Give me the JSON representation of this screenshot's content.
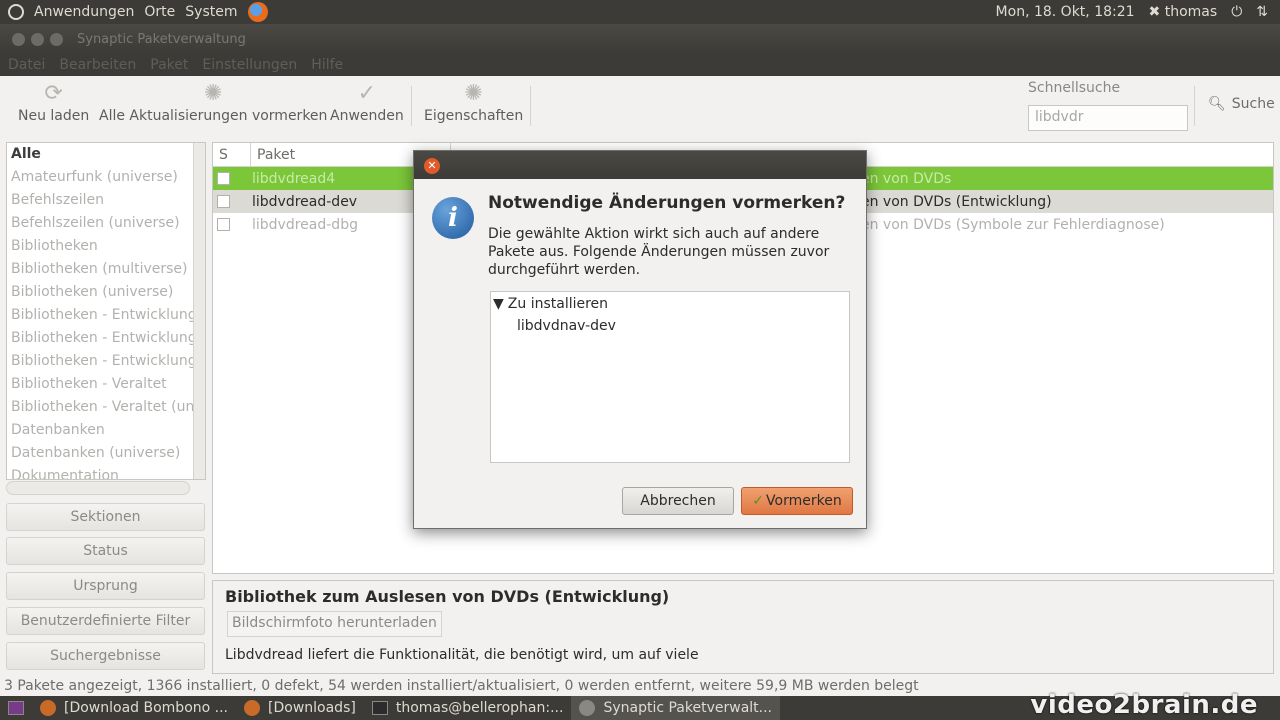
{
  "topbar": {
    "menus": [
      "Anwendungen",
      "Orte",
      "System"
    ],
    "clock": "Mon, 18. Okt, 18:21",
    "user": "thomas"
  },
  "window": {
    "title": "Synaptic Paketverwaltung",
    "menu": [
      "Datei",
      "Bearbeiten",
      "Paket",
      "Einstellungen",
      "Hilfe"
    ]
  },
  "toolbar": {
    "reload": "Neu laden",
    "mark_all": "Alle Aktualisierungen vormerken",
    "apply": "Anwenden",
    "properties": "Eigenschaften",
    "quicksearch_label": "Schnellsuche",
    "quicksearch_value": "libdvdr",
    "search": "Suche"
  },
  "sidebar": {
    "items": [
      "Alle",
      "Amateurfunk (universe)",
      "Befehlszeilen",
      "Befehlszeilen (universe)",
      "Bibliotheken",
      "Bibliotheken (multiverse)",
      "Bibliotheken (universe)",
      "Bibliotheken - Entwicklung",
      "Bibliotheken - Entwicklung",
      "Bibliotheken - Entwicklung",
      "Bibliotheken - Veraltet",
      "Bibliotheken - Veraltet (uni",
      "Datenbanken",
      "Datenbanken (universe)",
      "Dokumentation"
    ],
    "filters": [
      "Sektionen",
      "Status",
      "Ursprung",
      "Benutzerdefinierte Filter",
      "Suchergebnisse"
    ]
  },
  "pkglist": {
    "headers": [
      "S",
      "Paket"
    ],
    "rows": [
      {
        "name": "libdvdread4",
        "desc": "en von DVDs"
      },
      {
        "name": "libdvdread-dev",
        "desc": "en von DVDs (Entwicklung)"
      },
      {
        "name": "libdvdread-dbg",
        "desc": "en von DVDs (Symbole zur Fehlerdiagnose)"
      }
    ]
  },
  "details": {
    "title": "Bibliothek zum Auslesen von DVDs (Entwicklung)",
    "screenshot_button": "Bildschirmfoto herunterladen",
    "text": "Libdvdread liefert die Funktionalität, die benötigt wird, um auf viele"
  },
  "statusbar": "3 Pakete angezeigt, 1366 installiert, 0 defekt, 54 werden installiert/aktualisiert, 0 werden entfernt, weitere 59,9 MB werden belegt",
  "taskbar": [
    "[Download Bombono ...",
    "[Downloads]",
    "thomas@bellerophan:...",
    "Synaptic Paketverwalt..."
  ],
  "watermark": "video2brain.de",
  "dialog": {
    "heading": "Notwendige Änderungen vormerken?",
    "body": "Die gewählte Aktion wirkt sich auch auf andere Pakete aus. Folgende Änderungen müssen zuvor durchgeführt werden.",
    "tree_group": "Zu installieren",
    "tree_item": "libdvdnav-dev",
    "cancel": "Abbrechen",
    "ok": "Vormerken"
  }
}
